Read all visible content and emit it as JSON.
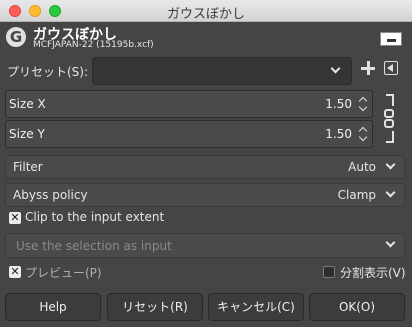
{
  "window": {
    "title": "ガウスぼかし"
  },
  "header": {
    "logo": "G",
    "title": "ガウスぼかし",
    "subtitle": "MCFJAPAN-22 (15195b.xcf)"
  },
  "presets": {
    "label": "プリセット(S):",
    "value": ""
  },
  "size_x": {
    "label": "Size X",
    "value": "1.50"
  },
  "size_y": {
    "label": "Size Y",
    "value": "1.50"
  },
  "filter": {
    "label": "Filter",
    "value": "Auto"
  },
  "abyss": {
    "label": "Abyss policy",
    "value": "Clamp"
  },
  "clip": {
    "label": "Clip to the input extent",
    "checked": true
  },
  "selection": {
    "label": "Use the selection as input",
    "enabled": false
  },
  "preview": {
    "label": "プレビュー(P)",
    "checked": true
  },
  "split_view": {
    "label": "分割表示(V)",
    "checked": false
  },
  "buttons": {
    "help": "Help",
    "reset": "リセット(R)",
    "cancel": "キャンセル(C)",
    "ok": "OK(O)"
  },
  "icons": {
    "logo": "gimp-logo-icon",
    "add_preset": "plus-icon",
    "preset_menu": "menu-arrow-icon",
    "chain": "chain-link-icon",
    "dropdown": "chevron-down-icon"
  },
  "colors": {
    "background": "#454545",
    "text": "#e6e6e6",
    "field": "#4a4a4a",
    "button": "#3c3c3c"
  }
}
